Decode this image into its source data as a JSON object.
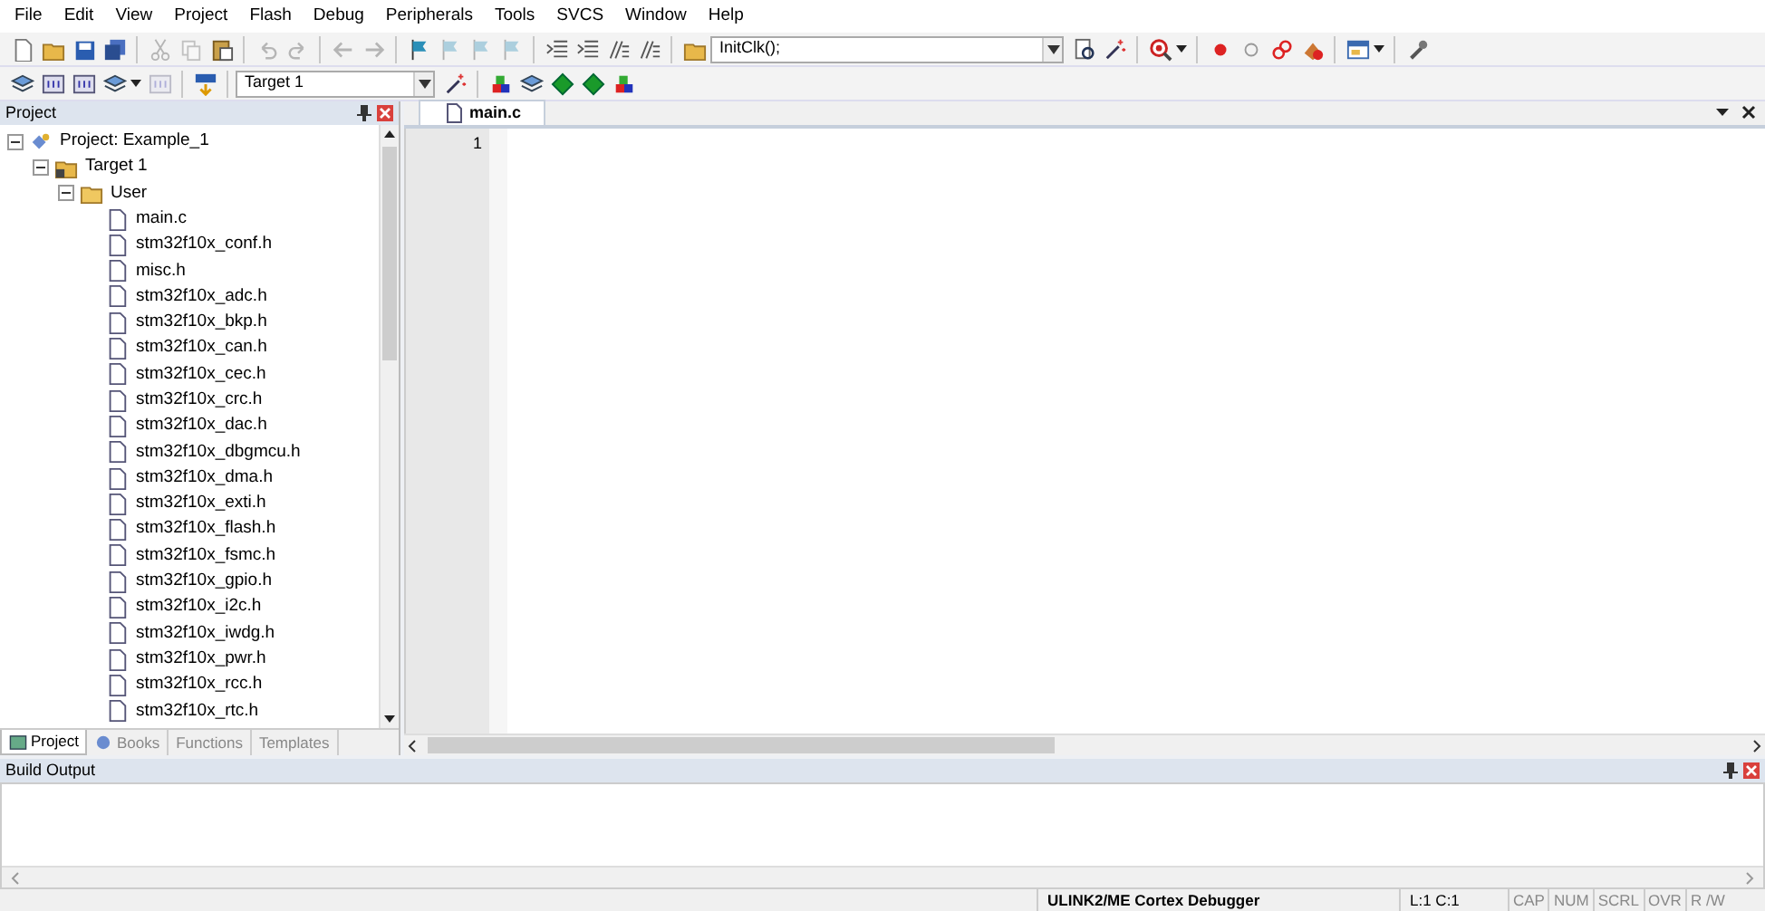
{
  "menu": [
    "File",
    "Edit",
    "View",
    "Project",
    "Flash",
    "Debug",
    "Peripherals",
    "Tools",
    "SVCS",
    "Window",
    "Help"
  ],
  "toolbar_1": [
    {
      "kind": "new",
      "disabled": false
    },
    {
      "kind": "open",
      "disabled": false
    },
    {
      "kind": "save",
      "disabled": false
    },
    {
      "kind": "saveall",
      "disabled": false
    },
    {
      "kind": "sep"
    },
    {
      "kind": "cut",
      "disabled": true
    },
    {
      "kind": "copy",
      "disabled": true
    },
    {
      "kind": "paste",
      "disabled": false
    },
    {
      "kind": "sep"
    },
    {
      "kind": "undo",
      "disabled": true
    },
    {
      "kind": "redo",
      "disabled": true
    },
    {
      "kind": "sep"
    },
    {
      "kind": "back",
      "disabled": true
    },
    {
      "kind": "forward",
      "disabled": true
    },
    {
      "kind": "sep"
    },
    {
      "kind": "bookmark",
      "disabled": false
    },
    {
      "kind": "bookmark",
      "disabled": true
    },
    {
      "kind": "bookmark",
      "disabled": true
    },
    {
      "kind": "bookmark",
      "disabled": true
    },
    {
      "kind": "sep"
    },
    {
      "kind": "indent",
      "disabled": false
    },
    {
      "kind": "indent",
      "disabled": false
    },
    {
      "kind": "comment",
      "disabled": false
    },
    {
      "kind": "comment",
      "disabled": false
    },
    {
      "kind": "sep"
    },
    {
      "kind": "open",
      "disabled": false
    },
    {
      "kind": "combo",
      "value": "InitClk();"
    },
    {
      "kind": "find",
      "disabled": false
    },
    {
      "kind": "wand",
      "disabled": false
    },
    {
      "kind": "sep"
    },
    {
      "kind": "debug",
      "disabled": false
    },
    {
      "kind": "caret"
    },
    {
      "kind": "sep"
    },
    {
      "kind": "dot",
      "disabled": false
    },
    {
      "kind": "ring",
      "disabled": false
    },
    {
      "kind": "chain",
      "disabled": false
    },
    {
      "kind": "kill",
      "disabled": false
    },
    {
      "kind": "sep"
    },
    {
      "kind": "window",
      "disabled": false
    },
    {
      "kind": "caret"
    },
    {
      "kind": "sep"
    },
    {
      "kind": "wrench",
      "disabled": false
    }
  ],
  "toolbar_2": [
    {
      "kind": "stack",
      "disabled": false
    },
    {
      "kind": "build",
      "disabled": false
    },
    {
      "kind": "build",
      "disabled": false
    },
    {
      "kind": "stack",
      "disabled": false
    },
    {
      "kind": "caret"
    },
    {
      "kind": "build",
      "disabled": true
    },
    {
      "kind": "sep"
    },
    {
      "kind": "load",
      "disabled": false
    },
    {
      "kind": "sep"
    },
    {
      "kind": "target",
      "value": "Target 1"
    },
    {
      "kind": "wand",
      "disabled": false
    },
    {
      "kind": "sep"
    },
    {
      "kind": "blocks",
      "disabled": false
    },
    {
      "kind": "stack",
      "disabled": false
    },
    {
      "kind": "diamond",
      "disabled": false
    },
    {
      "kind": "diamond",
      "disabled": false
    },
    {
      "kind": "blocks",
      "disabled": false
    }
  ],
  "project_pane": {
    "title": "Project",
    "tree": [
      {
        "label": "Project: Example_1",
        "kind": "project",
        "expanded": true,
        "children": [
          {
            "label": "Target 1",
            "kind": "target",
            "expanded": true,
            "children": [
              {
                "label": "User",
                "kind": "folder",
                "expanded": true,
                "children": [
                  {
                    "label": "main.c",
                    "kind": "file"
                  },
                  {
                    "label": "stm32f10x_conf.h",
                    "kind": "file"
                  },
                  {
                    "label": "misc.h",
                    "kind": "file"
                  },
                  {
                    "label": "stm32f10x_adc.h",
                    "kind": "file"
                  },
                  {
                    "label": "stm32f10x_bkp.h",
                    "kind": "file"
                  },
                  {
                    "label": "stm32f10x_can.h",
                    "kind": "file"
                  },
                  {
                    "label": "stm32f10x_cec.h",
                    "kind": "file"
                  },
                  {
                    "label": "stm32f10x_crc.h",
                    "kind": "file"
                  },
                  {
                    "label": "stm32f10x_dac.h",
                    "kind": "file"
                  },
                  {
                    "label": "stm32f10x_dbgmcu.h",
                    "kind": "file"
                  },
                  {
                    "label": "stm32f10x_dma.h",
                    "kind": "file"
                  },
                  {
                    "label": "stm32f10x_exti.h",
                    "kind": "file"
                  },
                  {
                    "label": "stm32f10x_flash.h",
                    "kind": "file"
                  },
                  {
                    "label": "stm32f10x_fsmc.h",
                    "kind": "file"
                  },
                  {
                    "label": "stm32f10x_gpio.h",
                    "kind": "file"
                  },
                  {
                    "label": "stm32f10x_i2c.h",
                    "kind": "file"
                  },
                  {
                    "label": "stm32f10x_iwdg.h",
                    "kind": "file"
                  },
                  {
                    "label": "stm32f10x_pwr.h",
                    "kind": "file"
                  },
                  {
                    "label": "stm32f10x_rcc.h",
                    "kind": "file"
                  },
                  {
                    "label": "stm32f10x_rtc.h",
                    "kind": "file"
                  }
                ]
              }
            ]
          }
        ]
      }
    ],
    "tabs": [
      {
        "label": "Project",
        "kind": "project",
        "selected": true
      },
      {
        "label": "Books",
        "kind": "books",
        "selected": false
      },
      {
        "label": "Functions",
        "kind": "functions",
        "selected": false
      },
      {
        "label": "Templates",
        "kind": "templates",
        "selected": false
      }
    ]
  },
  "editor": {
    "tabs": [
      {
        "label": "main.c",
        "selected": true
      }
    ],
    "line_numbers": [
      "1"
    ]
  },
  "build_output": {
    "title": "Build Output"
  },
  "status_bar": [
    {
      "text": "ULINK2/ME Cortex Debugger",
      "on": true
    },
    {
      "text": "L:1 C:1",
      "on": true
    },
    {
      "text": "CAP",
      "on": false
    },
    {
      "text": "NUM",
      "on": false
    },
    {
      "text": "SCRL",
      "on": false
    },
    {
      "text": "OVR",
      "on": false
    },
    {
      "text": "R /W",
      "on": false
    }
  ]
}
